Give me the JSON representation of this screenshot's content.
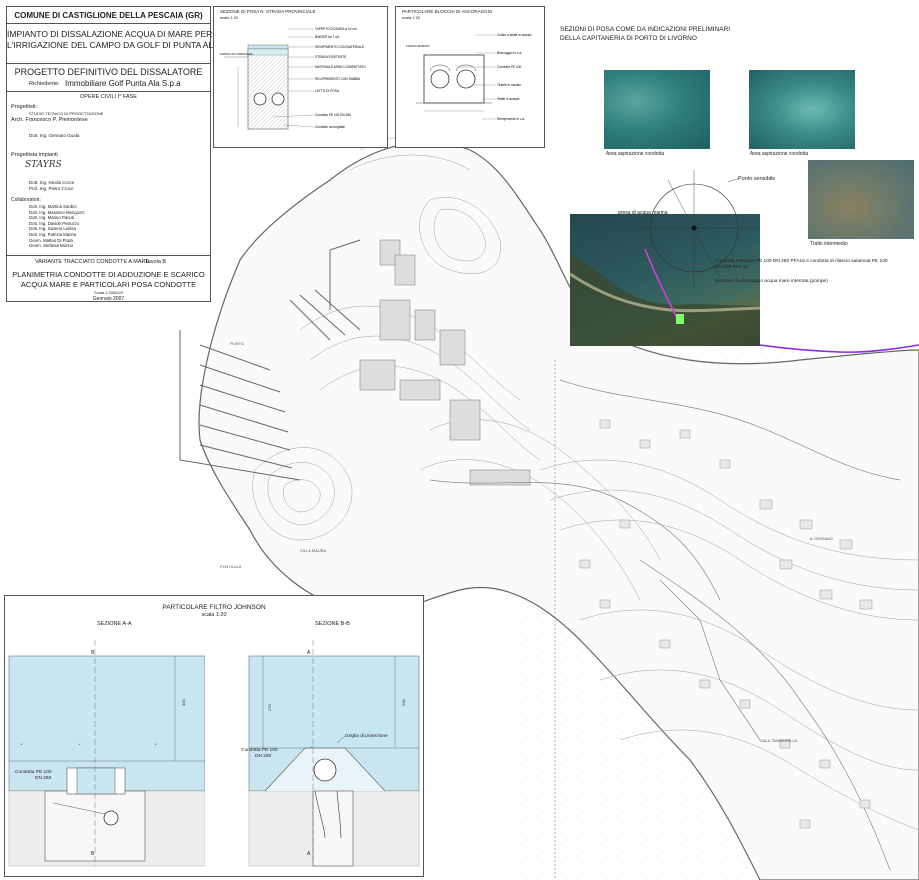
{
  "title_block": {
    "municipality": "COMUNE DI CASTIGLIONE DELLA PESCAIA (GR)",
    "project_line1": "IMPIANTO DI DISSALAZIONE ACQUA DI MARE PER",
    "project_line2": "L'IRRIGAZIONE DEL CAMPO DA GOLF DI PUNTA ALA",
    "project_phase": "PROGETTO DEFINITIVO DEL DISSALATORE",
    "client_label": "Richiedente:",
    "client_name": "Immobiliare Golf Punta Ala S.p.a",
    "works": "OPERE CIVILI  I° FASE",
    "designers_label": "Progettisti:",
    "studio": "STUDIO TECNICO DI PROGETTAZIONE",
    "architect": "Arch. Francesco P. Piemontese",
    "engineer": "Dott. Ing. Gennaro Guala",
    "plant_designers_label": "Progettista impianti",
    "logo_text": "STAYRS",
    "plant_designer1": "Dott. Ing. Nicola Croce",
    "plant_designer2": "Prof. Ing. Pietro Croce",
    "collaborators_label": "Collaboratori:",
    "collaborators": [
      "Dott. Ing. Martina Sardini",
      "Dott. Ing. Massimo Mengozzi",
      "Dott. Ing. Marino Pacuti",
      "Dott. Ing. Davide Petruzzo",
      "Dott. Ing. Saverio Ledisa",
      "Dott. Ing. Patrizia Mannu",
      "Geom. Matteo Di Prata",
      "Geom. Stefania Morino"
    ],
    "variant": "VARIANTE TRACCIATO CONDOTTE  A MARE",
    "table": "Tavola B",
    "drawing_title1": "PLANIMETRIA CONDOTTE DI ADDUZIONE E SCARICO",
    "drawing_title2": "ACQUA MARE E PARTICOLARI POSA CONDOTTE",
    "scale": "Scala  1:2000/20",
    "date": "Gennaio 2007"
  },
  "detail_road": {
    "title": "SEZIONE DI POSA N. STRADA PROVINCIALE",
    "scale": "scala 1:20",
    "labels": [
      "TAPPETO D'USURA a 10 cm",
      "BINDER da 7 cm",
      "RIEMPIMENTO CON MATERIALE",
      "STRADA ESISTENTE",
      "MATERIALE ARIDO COMPATTATO",
      "RICOPRIMENTO CON SABBIA",
      "LETTO DI POSA",
      "Condotta PE 100 DN 280",
      "Condotte convogliate"
    ],
    "left_label": "FONDO DI CAMPAGNA"
  },
  "detail_anchor": {
    "title": "PARTICOLARE BLOCCHI DI ANCORAGGIO",
    "scale": "scala 1:20",
    "labels": [
      "Collari a staffa in acciaio",
      "Bloccaggio in c.a.",
      "Condotta PE 100",
      "Tirante in acciaio",
      "Staffe in acciaio",
      "Riempimento in c.a."
    ],
    "left_label": "FONDO MARINO"
  },
  "sections_note": {
    "line1": "SEZIONI DI POSA COME DA INDICAZIONI PRELIMINARI",
    "line2": "DELLA CAPITANERIA DI PORTO DI LIVORNO"
  },
  "photos": {
    "photo1_caption": "Area aspirazione condotta",
    "photo2_caption": "Area aspirazione condotta",
    "photo3_caption": "Tratto intermedio"
  },
  "aerial": {
    "label_intake": "presa di acqua marina",
    "label_point": "Punto sensibile",
    "label_pipe1": "Condotta mandata PE 100 DN 280 PFA16 e condotta di rilascio salamoia  PE 100",
    "label_pipe2": "DN 200 PFA 16",
    "label_station": "stazione di pompaggio acqua mare interrata (pompe)"
  },
  "filter_detail": {
    "title": "PARTICOLARE FILTRO JOHNSON",
    "scale": "scala 1:20",
    "section_a": "SEZIONE A-A",
    "section_b": "SEZIONE B-B",
    "marker_b_top": "B",
    "marker_b_bottom": "B",
    "marker_a_top": "A",
    "marker_a_bottom": "A",
    "pipe_label1": "Condotta PE 100",
    "pipe_label2": "DN 280",
    "pipe_label3": "Condotta PE 100",
    "pipe_label4": "DN 280",
    "grid_label": "Griglia di protezione",
    "dim_a": "300",
    "dim_b": "200",
    "dim_c": "270"
  },
  "map_labels": {
    "bay": "PUNTA ALA",
    "hill": "VILLA MAURA",
    "harbor": "PORTO",
    "point": "PUNTA ALA",
    "village": "IL GRANAIO",
    "coast": "CALA TAMBERELLA"
  },
  "colors": {
    "water": "#c9e6f0",
    "pipe": "#8a2be2",
    "contour": "#9aa0a6",
    "aerial_sea": "#2d5a5e"
  }
}
